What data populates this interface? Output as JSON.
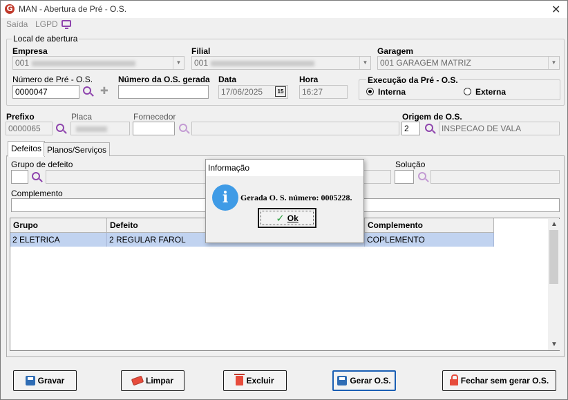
{
  "window": {
    "title": "MAN - Abertura de Pré - O.S.",
    "logo": "G"
  },
  "menu": {
    "saida": "Saída",
    "lgpd": "LGPD"
  },
  "local": {
    "legend": "Local de abertura",
    "empresa_label": "Empresa",
    "empresa_value": "001",
    "filial_label": "Filial",
    "filial_value": "001",
    "garagem_label": "Garagem",
    "garagem_value": "001 GARAGEM MATRIZ",
    "numero_pre_label": "Número de Pré - O.S.",
    "numero_pre_value": "0000047",
    "numero_os_label": "Número da O.S. gerada",
    "numero_os_value": "",
    "data_label": "Data",
    "data_value": "17/06/2025",
    "cal_text": "15",
    "hora_label": "Hora",
    "hora_value": "16:27",
    "execucao_legend": "Execução da Pré - O.S.",
    "interna_label": "Interna",
    "externa_label": "Externa"
  },
  "vehicle": {
    "prefixo_label": "Prefixo",
    "prefixo_value": "0000065",
    "placa_label": "Placa",
    "fornecedor_label": "Fornecedor",
    "origem_label": "Origem de O.S.",
    "origem_code": "2",
    "origem_desc": "INSPECAO DE VALA"
  },
  "tabs": {
    "defeitos": "Defeitos",
    "planos": "Planos/Serviços"
  },
  "defeitos": {
    "grupo_label": "Grupo de defeito",
    "solucao_label": "Solução",
    "complemento_label": "Complemento"
  },
  "grid": {
    "headers": {
      "grupo": "Grupo",
      "defeito": "Defeito",
      "complemento": "Complemento"
    },
    "rows": [
      {
        "grupo": "2 ELETRICA",
        "defeito": "2 REGULAR FAROL",
        "complemento": "COPLEMENTO"
      }
    ]
  },
  "buttons": {
    "gravar": "Gravar",
    "limpar": "Limpar",
    "excluir": "Excluir",
    "gerar": "Gerar O.S.",
    "fechar": "Fechar sem gerar O.S."
  },
  "dialog": {
    "title": "Informação",
    "message": "Gerada O. S. número: 0005228.",
    "ok": "Ok"
  }
}
